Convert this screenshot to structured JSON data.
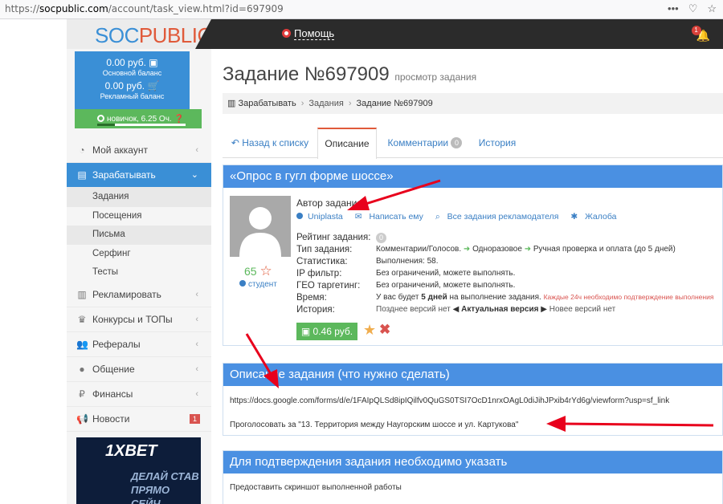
{
  "browser": {
    "url_prefix": "https://",
    "url_host": "socpublic.com",
    "url_path": "/account/task_view.html?id=697909"
  },
  "header": {
    "logo_part1": "SOC",
    "logo_part2": "PUBLIC",
    "help_label": "Помощь",
    "notif_count": "1"
  },
  "sidebar": {
    "main_balance": "0.00 руб.",
    "main_balance_label": "Основной баланс",
    "ad_balance": "0.00 руб.",
    "ad_balance_label": "Рекламный баланс",
    "level": "новичок, 6.25 Оч.",
    "level_progress": 0.2,
    "menu": [
      {
        "label": "Мой аккаунт"
      },
      {
        "label": "Зарабатывать"
      },
      {
        "label": "Рекламировать"
      },
      {
        "label": "Конкурсы и ТОПы"
      },
      {
        "label": "Рефералы"
      },
      {
        "label": "Общение"
      },
      {
        "label": "Финансы"
      },
      {
        "label": "Новости",
        "count": "1"
      }
    ],
    "submenu": [
      "Задания",
      "Посещения",
      "Письма",
      "Серфинг",
      "Тесты"
    ],
    "ad_brand": "1XBET",
    "ad_line1": "ДЕЛАЙ СТАВ",
    "ad_line2": "ПРЯМО СЕЙЧ"
  },
  "main": {
    "title": "Задание №697909",
    "subtitle": "просмотр задания",
    "breadcrumb": [
      "Зарабатывать",
      "Задания",
      "Задание №697909"
    ],
    "tabs": [
      {
        "label": "Назад к списку"
      },
      {
        "label": "Описание"
      },
      {
        "label": "Комментарии",
        "count": "0"
      },
      {
        "label": "История"
      }
    ]
  },
  "task": {
    "heading": "«Опрос в гугл форме шоссе»",
    "author_label": "Автор задания:",
    "author_links": [
      "Uniplasta",
      "Написать ему",
      "Все задания рекламодателя",
      "Жалоба"
    ],
    "rating_value": "65",
    "rank": "студент",
    "props": [
      {
        "k": "Рейтинг задания:",
        "v": ""
      },
      {
        "k": "Тип задания:",
        "v1": "Комментарии/Голосов.",
        "v2": "Одноразовое",
        "v3": "Ручная проверка и оплата (до 5 дней)"
      },
      {
        "k": "Статистика:",
        "v": "Выполнения:   58."
      },
      {
        "k": "IP фильтр:",
        "v": "Без ограничений, можете выполнять."
      },
      {
        "k": "ГЕО таргетинг:",
        "v": "Без ограничений, можете выполнять."
      },
      {
        "k": "Время:",
        "v_pre": "У вас будет ",
        "v_bold": "5 дней",
        "v_post": " на выполнение задания.",
        "v_red": "Каждые 24ч необходимо подтверждение выполнения"
      },
      {
        "k": "История:",
        "v_a": "Позднее версий нет",
        "v_b": "Актуальная версия",
        "v_c": "Новее версий нет"
      }
    ],
    "rating_badge": "0",
    "price": "0.46 руб."
  },
  "description": {
    "heading": "Описание задания (что нужно сделать)",
    "link": "https://docs.google.com/forms/d/e/1FAIpQLSd8ipIQilfv0QuGS0TSI7OcD1nrxOAgL0diJihJPxib4rYd6g/viewform?usp=sf_link",
    "text": "Проголосовать за \"13. Территория между Наугорским шоссе и ул. Картукова\""
  },
  "confirm": {
    "heading": "Для подтверждения задания необходимо указать",
    "text": "Предоставить скриншот выполненной работы"
  },
  "colors": {
    "brand_blue": "#4a90e2",
    "accent_green": "#5cb85c",
    "annotation_red": "#e8001c"
  }
}
